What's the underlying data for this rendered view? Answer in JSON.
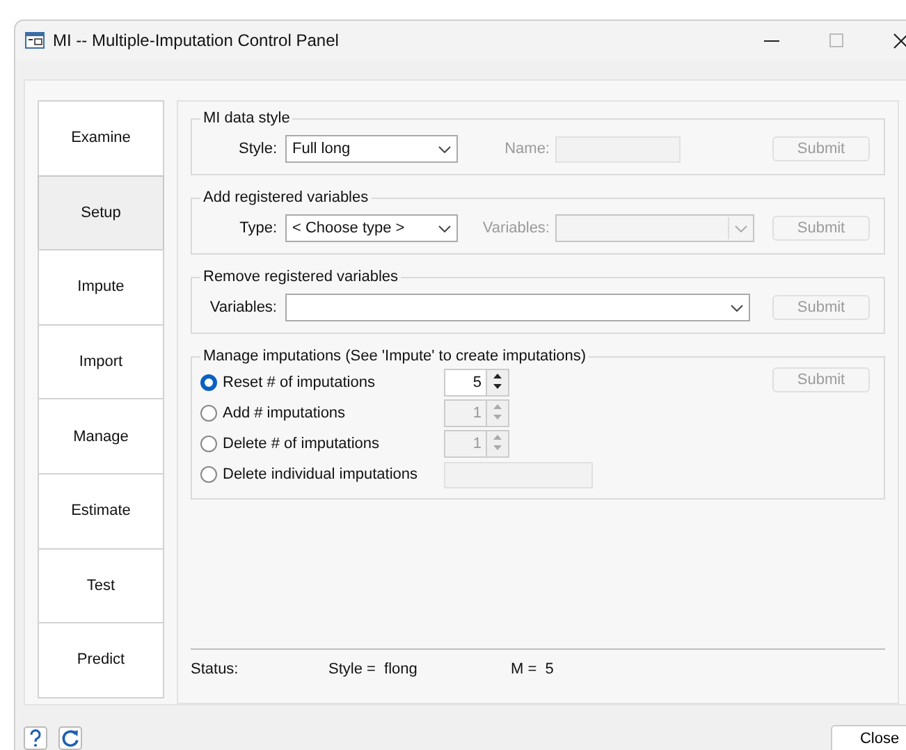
{
  "window": {
    "title": "MI -- Multiple-Imputation Control Panel"
  },
  "tabs": [
    {
      "label": "Examine",
      "selected": false
    },
    {
      "label": "Setup",
      "selected": true
    },
    {
      "label": "Impute",
      "selected": false
    },
    {
      "label": "Import",
      "selected": false
    },
    {
      "label": "Manage",
      "selected": false
    },
    {
      "label": "Estimate",
      "selected": false
    },
    {
      "label": "Test",
      "selected": false
    },
    {
      "label": "Predict",
      "selected": false
    }
  ],
  "groups": [
    {
      "title": "MI data style",
      "fields": [
        {
          "label": "Style:",
          "kind": "dropdown",
          "value": "Full long",
          "disabled": false
        },
        {
          "label": "Name:",
          "kind": "text",
          "disabled": true
        }
      ],
      "submit": {
        "label": "Submit",
        "disabled": true
      }
    },
    {
      "title": "Add registered variables",
      "fields": [
        {
          "label": "Type:",
          "kind": "dropdown",
          "value": "< Choose type >",
          "disabled": false
        },
        {
          "label": "Variables:",
          "kind": "dropdown",
          "disabled": true
        }
      ],
      "submit": {
        "label": "Submit",
        "disabled": true
      }
    },
    {
      "title": "Remove registered variables",
      "fields": [
        {
          "label": "Variables:",
          "kind": "dropdown",
          "disabled": false
        }
      ],
      "submit": {
        "label": "Submit",
        "disabled": true
      }
    }
  ],
  "manage": {
    "title": "Manage imputations (See 'Impute' to create imputations)",
    "options": [
      {
        "label": "Reset # of imputations",
        "selected": true,
        "kind": "spinner",
        "value": "5",
        "disabled": false
      },
      {
        "label": "Add # imputations",
        "selected": false,
        "kind": "spinner",
        "value": "1",
        "disabled": true
      },
      {
        "label": "Delete # of imputations",
        "selected": false,
        "kind": "spinner",
        "value": "1",
        "disabled": true
      },
      {
        "label": "Delete individual imputations",
        "selected": false,
        "kind": "text",
        "disabled": true
      }
    ],
    "submit": {
      "label": "Submit",
      "disabled": true
    }
  },
  "status": {
    "label": "Status:",
    "style": "Style =  flong",
    "m": "M =  5"
  },
  "footer": {
    "close": "Close"
  }
}
